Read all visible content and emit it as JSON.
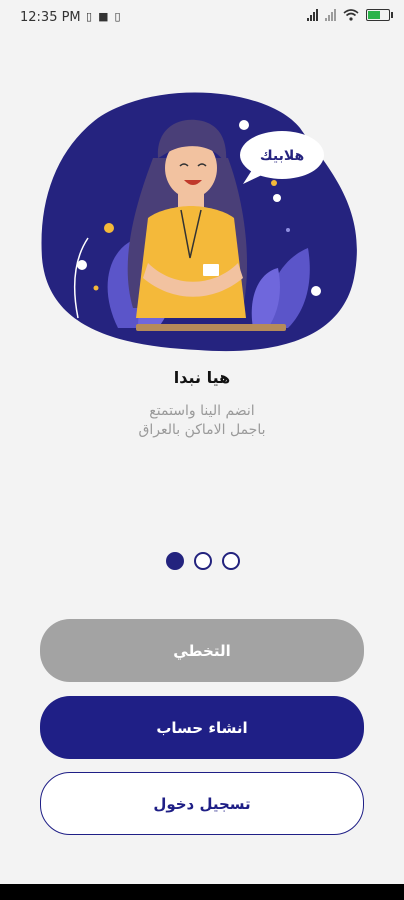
{
  "status": {
    "time": "12:35 PM",
    "left_icons": [
      "sim-icon",
      "notification-icon",
      "sim-icon"
    ],
    "right_icons": [
      "signal-icon",
      "signal-icon",
      "wifi-icon",
      "battery-icon"
    ]
  },
  "hero": {
    "speech_bubble": "هلابيك"
  },
  "onboarding": {
    "title": "هيا نبدا",
    "subtitle_line1": "انضم الينا واستمتع",
    "subtitle_line2": "باجمل الاماكن بالعراق",
    "page_count": 3,
    "active_page": 1
  },
  "buttons": {
    "skip": "التخطي",
    "create_account": "انشاء حساب",
    "login": "تسجيل دخول"
  },
  "colors": {
    "primary": "#1f1f86",
    "skip_button": "#a3a3a3",
    "background": "#f3f3f3",
    "shirt": "#f4b93a"
  }
}
